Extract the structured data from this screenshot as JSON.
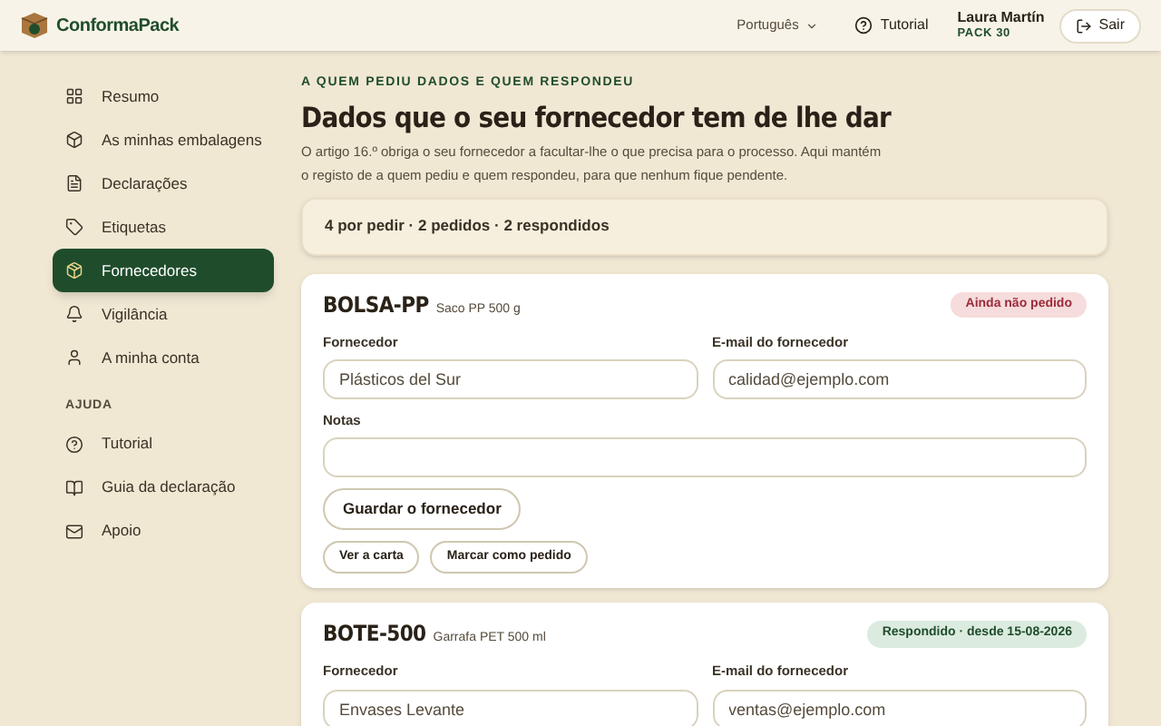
{
  "header": {
    "logo": "ConformaPack",
    "language": "Português",
    "tutorial": "Tutorial",
    "user": {
      "name": "Laura Martín",
      "plan": "PACK 30"
    },
    "logout": "Sair"
  },
  "sidebar": {
    "items": [
      {
        "label": "Resumo",
        "selected": false
      },
      {
        "label": "As minhas embalagens",
        "selected": false
      },
      {
        "label": "Declarações",
        "selected": false
      },
      {
        "label": "Etiquetas",
        "selected": false
      },
      {
        "label": "Fornecedores",
        "selected": true
      },
      {
        "label": "Vigilância",
        "selected": false
      },
      {
        "label": "A minha conta",
        "selected": false
      }
    ],
    "help_heading": "AJUDA",
    "help_items": [
      {
        "label": "Tutorial",
        "selected": false
      },
      {
        "label": "Guia da declaração",
        "selected": false
      },
      {
        "label": "Apoio",
        "selected": false
      }
    ]
  },
  "page": {
    "eyebrow": "A QUEM PEDIU DADOS E QUEM RESPONDEU",
    "title": "Dados que o seu fornecedor tem de lhe dar",
    "intro": "O artigo 16.º obriga o seu fornecedor a facultar-lhe o que precisa para o processo. Aqui mantém o registo de a quem pediu e quem respondeu, para que nenhum fique pendente.",
    "summary": "4 por pedir · 2 pedidos · 2 respondidos"
  },
  "cards": [
    {
      "code": "BOLSA-PP",
      "description": "Saco PP 500 g",
      "status": {
        "kind": "pending",
        "label": "Ainda não pedido"
      },
      "supplier_label": "Fornecedor",
      "supplier": "Plásticos del Sur",
      "email_label": "E-mail do fornecedor",
      "email": "calidad@ejemplo.com",
      "notes_label": "Notas",
      "save_button": "Guardar o fornecedor",
      "actions": [
        "Ver a carta",
        "Marcar como pedido"
      ]
    },
    {
      "code": "BOTE-500",
      "description": "Garrafa PET 500 ml",
      "status": {
        "kind": "responded",
        "label": "Respondido · desde 15-08-2026"
      },
      "supplier_label": "Fornecedor",
      "supplier": "Envases Levante",
      "email_label": "E-mail do fornecedor",
      "email": "ventas@ejemplo.com"
    }
  ]
}
